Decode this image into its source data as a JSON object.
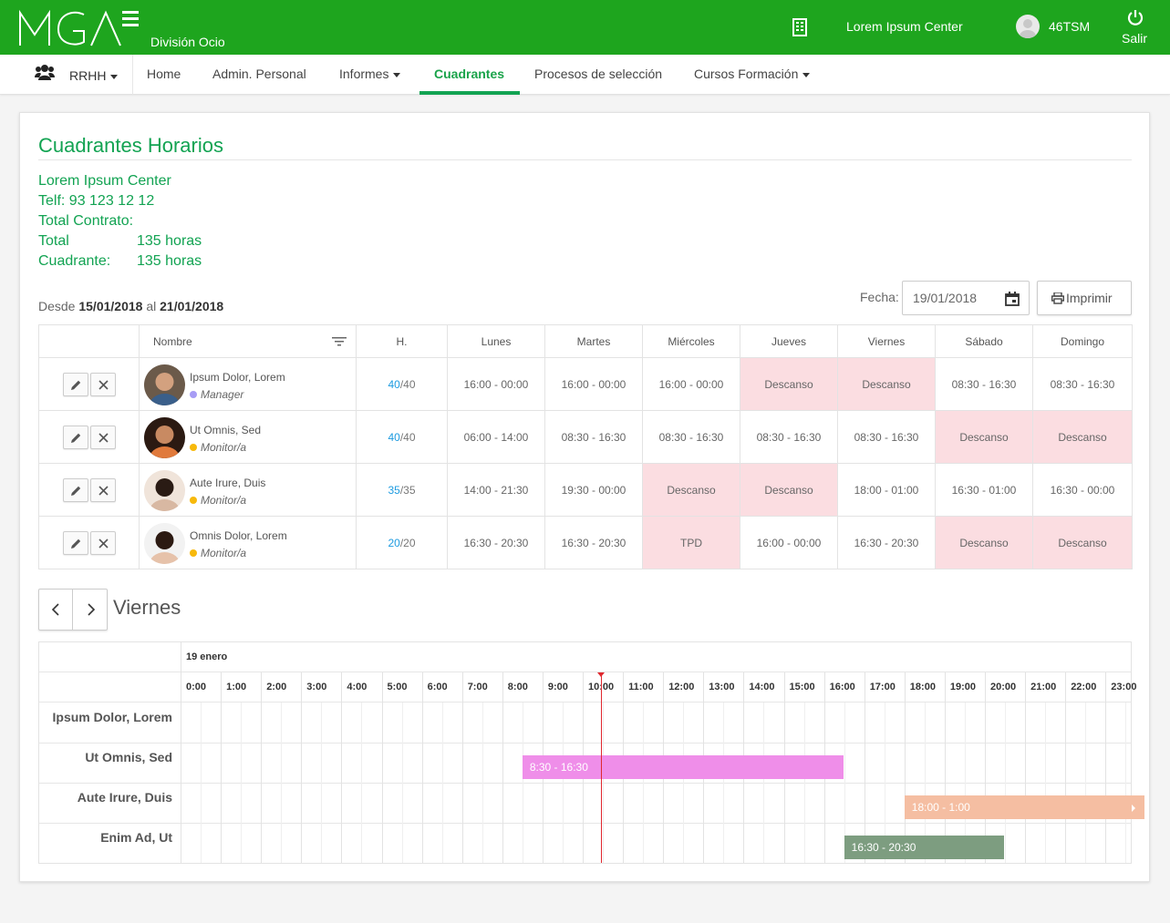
{
  "header": {
    "logo_text": "MGA",
    "division": "División Ocio",
    "center": "Lorem Ipsum Center",
    "user": "46TSM",
    "logout": "Salir",
    "brand_color": "#1ea51e"
  },
  "nav": {
    "group": "RRHH",
    "items": [
      {
        "label": "Home",
        "active": false
      },
      {
        "label": "Admin. Personal",
        "active": false
      },
      {
        "label": "Informes",
        "active": false,
        "dropdown": true
      },
      {
        "label": "Cuadrantes",
        "active": true
      },
      {
        "label": "Procesos de selección",
        "active": false
      },
      {
        "label": "Cursos Formación",
        "active": false,
        "dropdown": true
      }
    ]
  },
  "page": {
    "title": "Cuadrantes Horarios",
    "center": "Lorem Ipsum Center",
    "phone": "Telf: 93 123 12 12",
    "total_contract_label": "Total Contrato:",
    "total_label": "Total",
    "total_value": "135 horas",
    "quadrant_label": "Cuadrante:",
    "quadrant_value": "135 horas",
    "range_prefix": "Desde",
    "range_from": "15/01/2018",
    "range_mid": "al",
    "range_to": "21/01/2018",
    "date_label": "Fecha:",
    "date_value": "19/01/2018",
    "print_label": "Imprimir"
  },
  "table": {
    "headers": {
      "name": "Nombre",
      "hours": "H.",
      "days": [
        "Lunes",
        "Martes",
        "Miércoles",
        "Jueves",
        "Viernes",
        "Sábado",
        "Domingo"
      ]
    },
    "rows": [
      {
        "name": "Ipsum Dolor, Lorem",
        "role": "Manager",
        "role_color": "#a79cf5",
        "hours_done": "40",
        "hours_total": "/40",
        "days": [
          "16:00 - 00:00",
          "16:00 - 00:00",
          "16:00 - 00:00",
          "Descanso",
          "Descanso",
          "08:30 - 16:30",
          "08:30 - 16:30"
        ]
      },
      {
        "name": "Ut Omnis, Sed",
        "role": "Monitor/a",
        "role_color": "#f7b90b",
        "hours_done": "40",
        "hours_total": "/40",
        "days": [
          "06:00 - 14:00",
          "08:30 - 16:30",
          "08:30 - 16:30",
          "08:30 - 16:30",
          "08:30 - 16:30",
          "Descanso",
          "Descanso"
        ]
      },
      {
        "name": "Aute Irure, Duis",
        "role": "Monitor/a",
        "role_color": "#f7b90b",
        "hours_done": "35",
        "hours_total": "/35",
        "days": [
          "14:00 - 21:30",
          "19:30 - 00:00",
          "Descanso",
          "Descanso",
          "18:00 - 01:00",
          "16:30 - 01:00",
          "16:30 - 00:00"
        ]
      },
      {
        "name": "Omnis Dolor, Lorem",
        "role": "Monitor/a",
        "role_color": "#f7b90b",
        "hours_done": "20",
        "hours_total": "/20",
        "days": [
          "16:30 - 20:30",
          "16:30 - 20:30",
          "TPD",
          "16:00 - 00:00",
          "16:30 - 20:30",
          "Descanso",
          "Descanso"
        ]
      }
    ]
  },
  "timeline": {
    "day_title": "Viernes",
    "date_label": "19 enero",
    "hours": [
      "0:00",
      "1:00",
      "2:00",
      "3:00",
      "4:00",
      "5:00",
      "6:00",
      "7:00",
      "8:00",
      "9:00",
      "10:00",
      "11:00",
      "12:00",
      "13:00",
      "14:00",
      "15:00",
      "16:00",
      "17:00",
      "18:00",
      "19:00",
      "20:00",
      "21:00",
      "22:00",
      "23:00"
    ],
    "now_hour": 10.45,
    "rows": [
      {
        "name": "Ipsum Dolor, Lorem"
      },
      {
        "name": "Ut Omnis, Sed",
        "bar": {
          "label": "8:30 - 16:30",
          "start": 8.5,
          "end": 16.5,
          "color": "#ef8ee9"
        }
      },
      {
        "name": "Aute Irure, Duis",
        "bar": {
          "label": "18:00 - 1:00",
          "start": 18,
          "end": 24,
          "color": "#f5bea2",
          "continues": true
        }
      },
      {
        "name": "Enim Ad, Ut",
        "bar": {
          "label": "16:30 - 20:30",
          "start": 16.5,
          "end": 20.5,
          "color": "#7d9d80"
        }
      }
    ]
  }
}
